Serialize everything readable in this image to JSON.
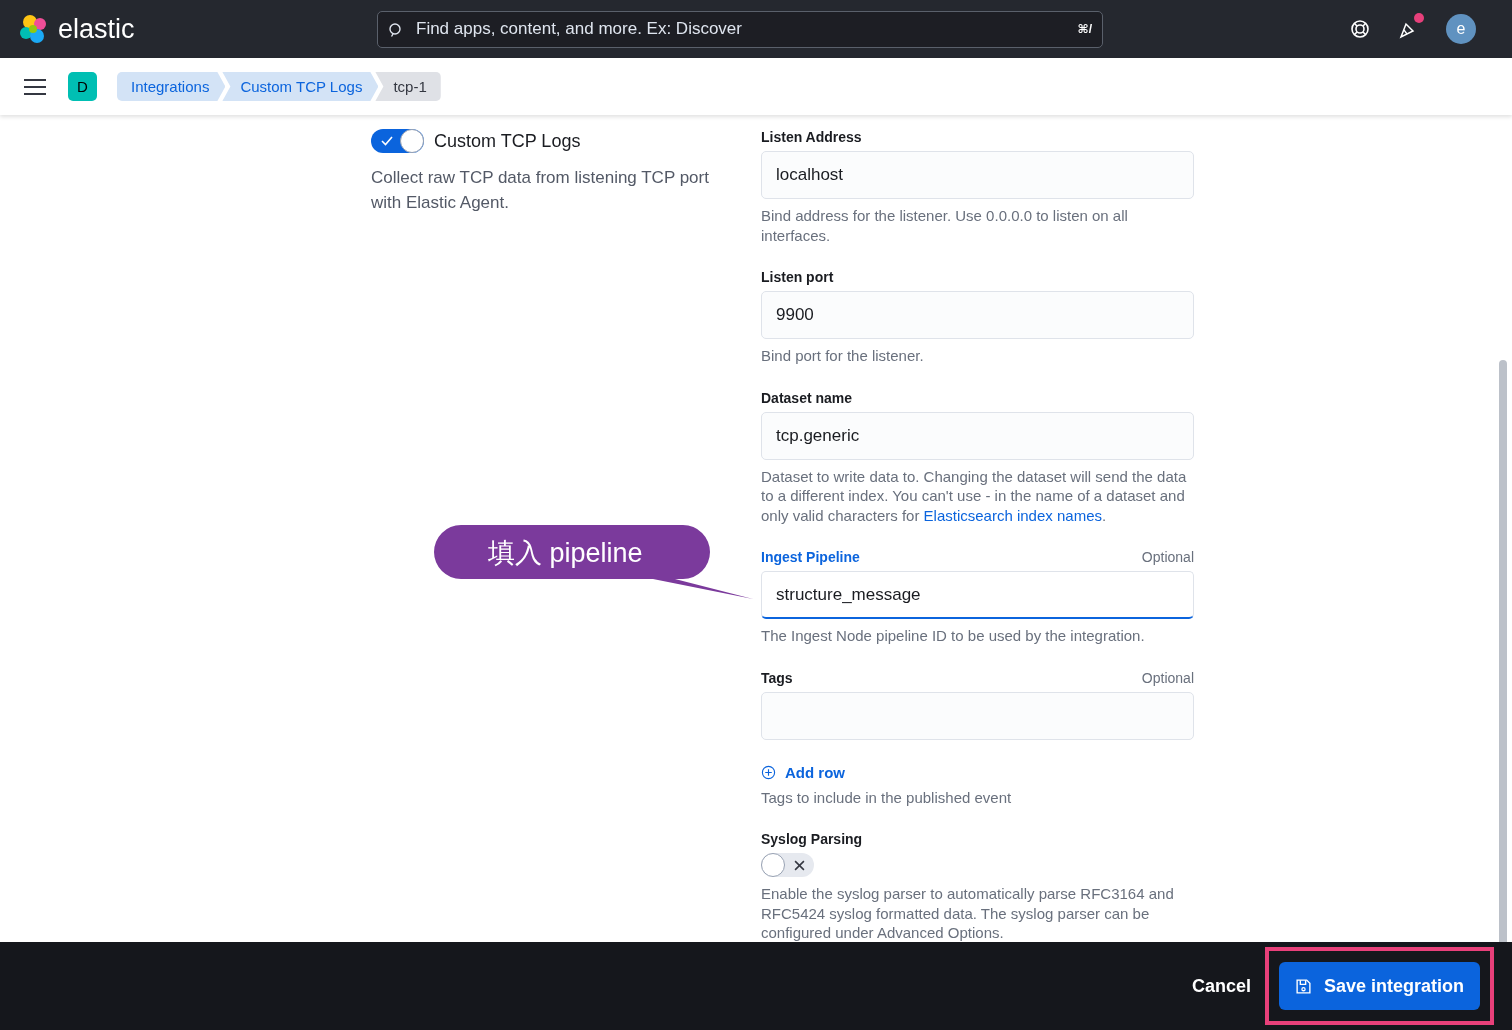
{
  "header": {
    "logo_text": "elastic",
    "search_placeholder": "Find apps, content, and more. Ex: Discover",
    "search_shortcut": "⌘/",
    "avatar": "e",
    "news_badge": true
  },
  "breadcrumbs": {
    "space": "D",
    "items": [
      {
        "label": "Integrations",
        "current": false
      },
      {
        "label": "Custom TCP Logs",
        "current": false
      },
      {
        "label": "tcp-1",
        "current": true
      }
    ]
  },
  "integration": {
    "on": true,
    "title": "Custom TCP Logs",
    "description": "Collect raw TCP data from listening TCP port with Elastic Agent."
  },
  "fields": [
    {
      "kind": "text",
      "label": "Listen Address",
      "value": "localhost",
      "focused": false,
      "help": "Bind address for the listener. Use 0.0.0.0 to listen on all interfaces."
    },
    {
      "kind": "text",
      "label": "Listen port",
      "value": "9900",
      "focused": false,
      "help": "Bind port for the listener."
    },
    {
      "kind": "text",
      "label": "Dataset name",
      "value": "tcp.generic",
      "focused": false,
      "help": "Dataset to write data to. Changing the dataset will send the data to a different index. You can't use - in the name of a dataset and only valid characters for ",
      "help_link": "Elasticsearch index names",
      "help_after": "."
    },
    {
      "kind": "text",
      "label": "Ingest Pipeline",
      "optional": "Optional",
      "value": "structure_message",
      "focused": true,
      "help": "The Ingest Node pipeline ID to be used by the integration."
    },
    {
      "kind": "list",
      "label": "Tags",
      "optional": "Optional",
      "focused": false,
      "add_row": "Add row",
      "help": "Tags to include in the published event"
    },
    {
      "kind": "switch",
      "label": "Syslog Parsing",
      "on": false,
      "help": "Enable the syslog parser to automatically parse RFC3164 and RFC5424 syslog formatted data. The syslog parser can be configured under Advanced Options."
    }
  ],
  "callout": {
    "text": "填入 pipeline"
  },
  "footer": {
    "cancel": "Cancel",
    "save": "Save integration",
    "highlighted": true
  }
}
